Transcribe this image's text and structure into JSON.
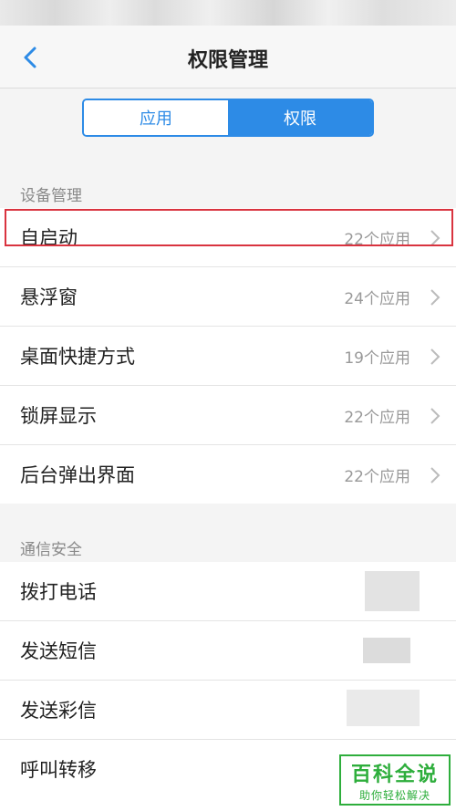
{
  "header": {
    "title": "权限管理"
  },
  "segment": {
    "left_label": "应用",
    "right_label": "权限"
  },
  "sections": [
    {
      "label": "设备管理",
      "items": [
        {
          "title": "自启动",
          "count": "22个应用"
        },
        {
          "title": "悬浮窗",
          "count": "24个应用"
        },
        {
          "title": "桌面快捷方式",
          "count": "19个应用"
        },
        {
          "title": "锁屏显示",
          "count": "22个应用"
        },
        {
          "title": "后台弹出界面",
          "count": "22个应用"
        }
      ]
    },
    {
      "label": "通信安全",
      "items": [
        {
          "title": "拨打电话"
        },
        {
          "title": "发送短信"
        },
        {
          "title": "发送彩信"
        },
        {
          "title": "呼叫转移"
        }
      ]
    }
  ],
  "watermark": {
    "main": "百科全说",
    "sub": "助你轻松解决"
  },
  "colors": {
    "accent": "#2d8be6",
    "highlight": "#d9333f",
    "watermark": "#2eae3c"
  }
}
